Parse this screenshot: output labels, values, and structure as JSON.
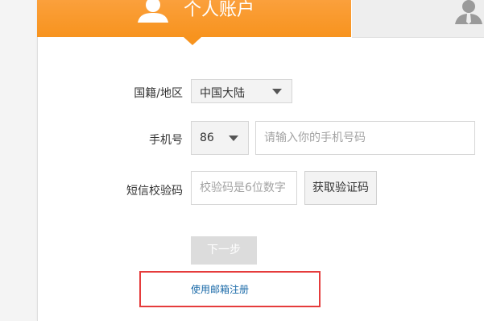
{
  "tabs": {
    "personal": {
      "label": "个人账户",
      "icon": "user-icon",
      "active": true
    },
    "company": {
      "icon": "business-user-icon",
      "active": false
    }
  },
  "form": {
    "nationality": {
      "label": "国籍/地区",
      "value": "中国大陆"
    },
    "phone": {
      "label": "手机号",
      "code": "86",
      "placeholder": "请输入你的手机号码"
    },
    "sms": {
      "label": "短信校验码",
      "placeholder": "校验码是6位数字",
      "button": "获取验证码"
    },
    "next_button": "下一步",
    "email_link": "使用邮箱注册"
  },
  "colors": {
    "accent": "#f7931e",
    "highlight_border": "#e53c3c",
    "link": "#1a6aa8"
  }
}
